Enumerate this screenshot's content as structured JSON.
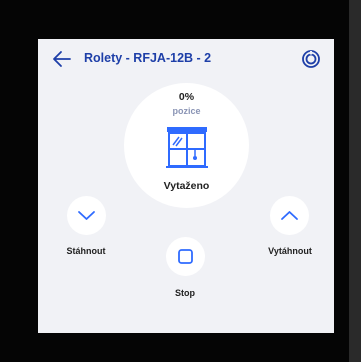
{
  "header": {
    "title": "Rolety - RFJA-12B - 2",
    "back_icon": "arrow-left-icon",
    "settings_icon": "settings-icon"
  },
  "status": {
    "position_value": "0%",
    "position_label": "pozice",
    "position_fraction": 0,
    "state": "Vytaženo",
    "illustration_icon": "window-blind-icon"
  },
  "controls": {
    "down_label": "Stáhnout",
    "up_label": "Vytáhnout",
    "stop_label": "Stop",
    "down_icon": "chevron-down-icon",
    "up_icon": "chevron-up-icon",
    "stop_icon": "stop-square-icon"
  },
  "colors": {
    "accent": "#1e3fa8",
    "icon_blue": "#2f6bff",
    "screen_background": "#f1f2f6",
    "button_background": "#ffffff"
  }
}
